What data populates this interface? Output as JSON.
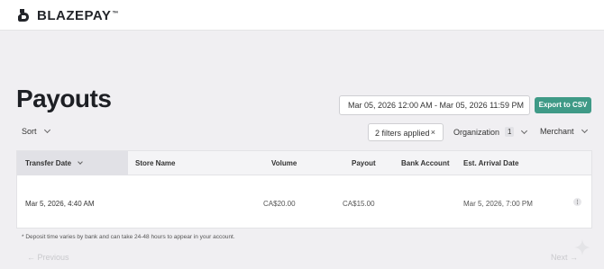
{
  "brand": {
    "name": "BLAZEPAY",
    "tm": "™"
  },
  "page": {
    "title": "Payouts"
  },
  "toolbar": {
    "date_range": "Mar 05, 2026 12:00 AM - Mar 05, 2026 11:59 PM",
    "export_label": "Export to CSV",
    "sort_label": "Sort",
    "filters_label": "2 filters applied",
    "filters_clear": "×",
    "organization_label": "Organization",
    "organization_count": "1",
    "merchant_label": "Merchant"
  },
  "table": {
    "columns": [
      "Transfer Date",
      "Store Name",
      "Volume",
      "Payout",
      "Bank Account",
      "Est. Arrival Date"
    ],
    "rows": [
      {
        "transfer_date": "Mar 5, 2026, 4:40 AM",
        "store_name": "",
        "volume": "CA$20.00",
        "payout": "CA$15.00",
        "bank_account": "",
        "est_arrival": "Mar 5, 2026, 7:00 PM"
      }
    ]
  },
  "footnote": "* Deposit time varies by bank and can take 24-48 hours to appear in your account.",
  "pagination": {
    "prev": "← Previous",
    "next": "Next →"
  },
  "colors": {
    "accent": "#3f9a87",
    "brand_dark": "#23252a"
  },
  "icons": [
    "logo-mark-icon",
    "chevron-down-icon",
    "close-icon",
    "kebab-menu-icon",
    "sparkle-icon"
  ]
}
